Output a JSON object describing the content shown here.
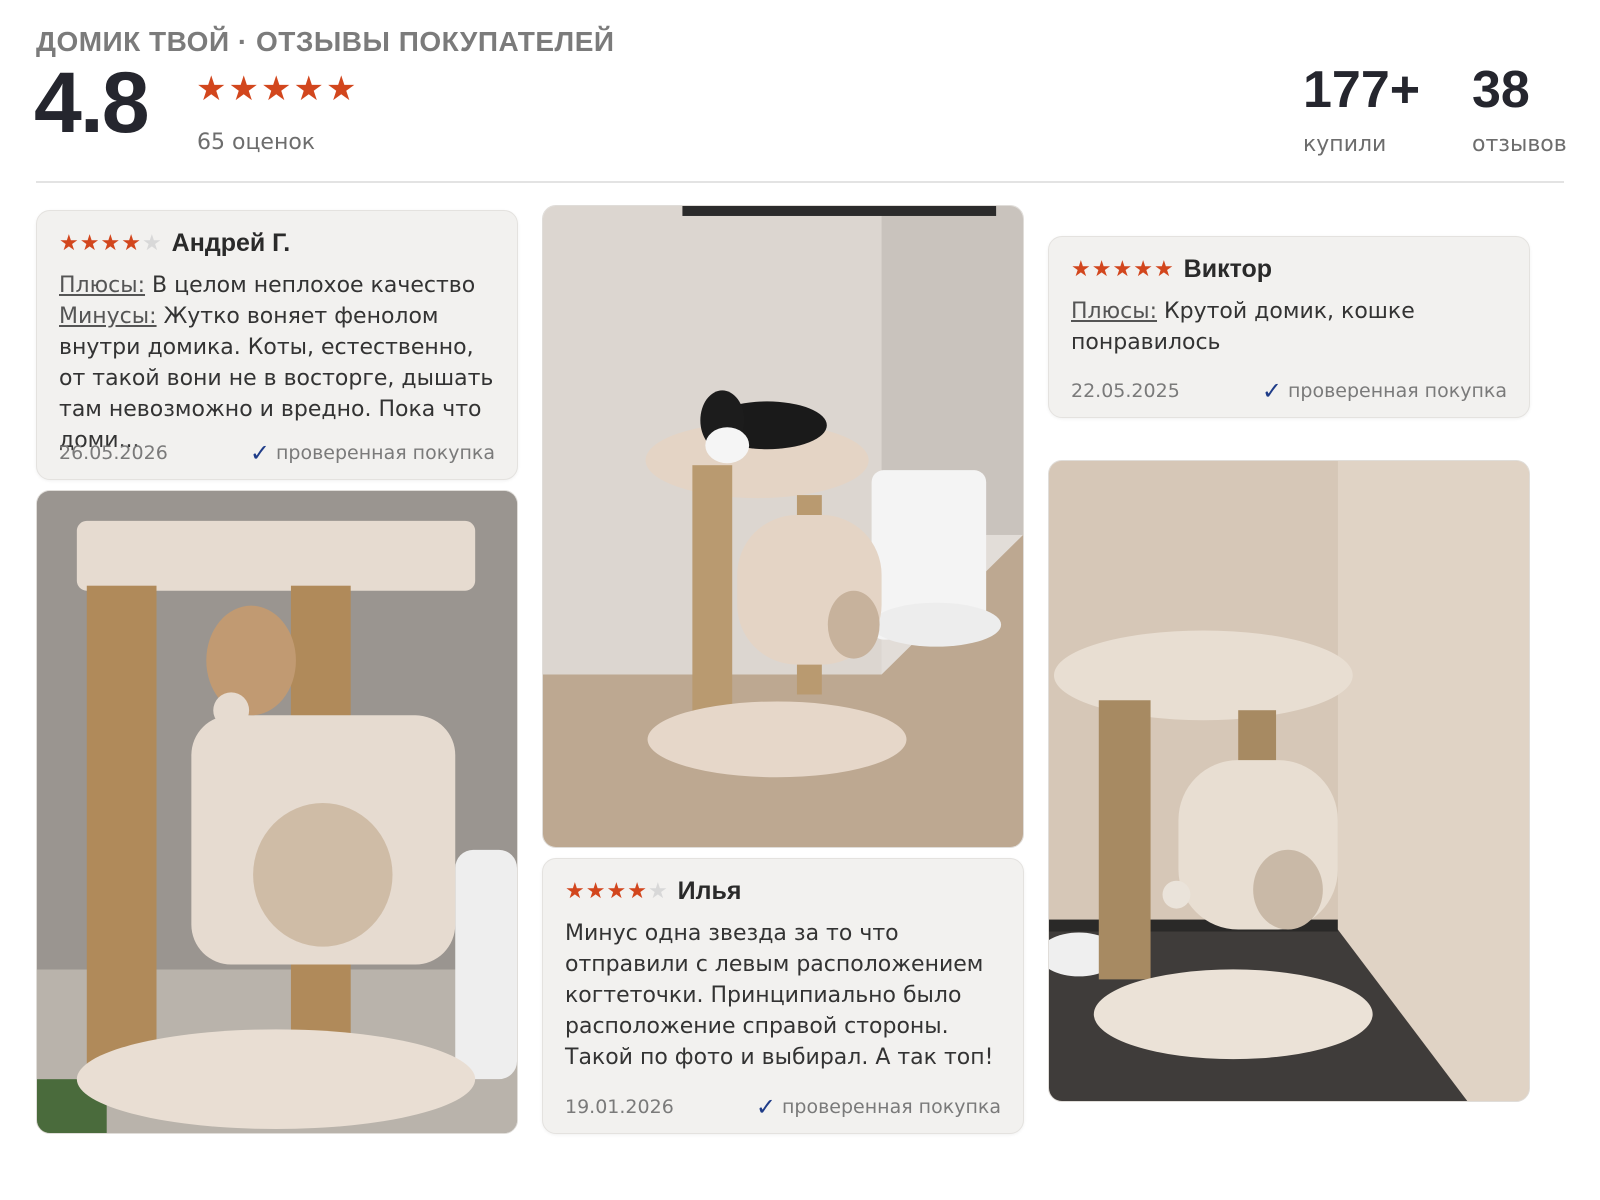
{
  "header": {
    "brand": "ДОМИК ТВОЙ · ОТЗЫВЫ ПОКУПАТЕЛЕЙ",
    "rating": "4.8",
    "rating_stars": 5,
    "ratings_count": "65 оценок",
    "bought_value": "177+",
    "bought_label": "купили",
    "reviews_value": "38",
    "reviews_label": "отзывов"
  },
  "colors": {
    "star": "#d2461d",
    "star_off": "#d8d8d8",
    "check": "#1f3c88",
    "card_bg": "#f2f1ef"
  },
  "reviews": [
    {
      "author": "Андрей Г.",
      "stars": 4,
      "pros_label": "Плюсы:",
      "pros": "В целом неплохое качество",
      "cons_label": "Минусы:",
      "cons": "Жутко воняет фенолом внутри домика. Коты, естественно, от такой вони не в восторге, дышать там невозможно и вредно. Пока что доми...",
      "date": "26.05.2026",
      "verified": "проверенная покупка"
    },
    {
      "author": "Виктор",
      "stars": 5,
      "pros_label": "Плюсы:",
      "pros": "Крутой домик, кошке понравилось",
      "date": "22.05.2025",
      "verified": "проверенная покупка"
    },
    {
      "author": "Илья",
      "stars": 4,
      "text": "Минус одна звезда за то что отправили с левым расположением когтеточки. Принципиально было расположение справой стороны. Такой по фото и выбирал. А так топ!",
      "date": "19.01.2026",
      "verified": "проверенная покупка"
    }
  ]
}
